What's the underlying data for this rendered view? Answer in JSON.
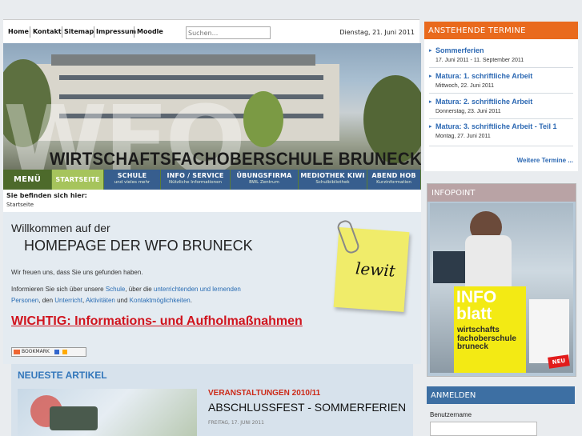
{
  "topnav": {
    "links": [
      "Home",
      "Kontakt",
      "Sitemap",
      "Impressum",
      "Moodle"
    ],
    "search_placeholder": "Suchen...",
    "date": "Dienstag, 21. Juni 2011"
  },
  "header": {
    "watermark": "WFO",
    "school_name": "WIRTSCHAFTSFACHOBERSCHULE BRUNECK"
  },
  "menu": {
    "menu_label": "MENÜ",
    "start_label": "STARTSEITE",
    "items": [
      {
        "title": "SCHULE",
        "sub": "und vieles mehr"
      },
      {
        "title": "INFO / SERVICE",
        "sub": "Nützliche Informationen"
      },
      {
        "title": "ÜBUNGSFIRMA",
        "sub": "BWL Zentrum"
      },
      {
        "title": "MEDIOTHEK KIWI",
        "sub": "Schulbibliothek"
      },
      {
        "title": "ABEND HOB",
        "sub": "Kurzinformation"
      }
    ]
  },
  "breadcrumb": {
    "label": "Sie befinden sich hier:",
    "current": "Startseite"
  },
  "welcome": {
    "line1": "Willkommen auf der",
    "line2": "HOMEPAGE DER WFO BRUNECK",
    "p1": "Wir freuen uns, dass Sie uns gefunden haben.",
    "p2_a": "Informieren Sie sich über unsere ",
    "link_schule": "Schule",
    "p2_b": ", über die ",
    "link_personen_1": "unterrichtenden und lernenden",
    "link_personen_2": "Personen",
    "p3_a": ", den ",
    "link_unterricht": "Unterricht",
    "p3_b": ", ",
    "link_aktivitaeten": "Aktivitäten",
    "p3_c": " und ",
    "link_kontakt": "Kontaktmöglichkeiten",
    "p3_d": ".",
    "wichtig": "WICHTIG: Informations- und Aufholmaßnahmen",
    "bookmark": "BOOKMARK",
    "note_text": "lewit"
  },
  "articles": {
    "title": "NEUESTE ARTIKEL",
    "category": "VERANSTALTUNGEN 2010/11",
    "headline": "ABSCHLUSSFEST - SOMMERFERIEN",
    "date": "FREITAG, 17. JUNI 2011"
  },
  "termine": {
    "title": "ANSTEHENDE TERMINE",
    "events": [
      {
        "name": "Sommerferien",
        "date": "17. Juni 2011 - 11. September 2011"
      },
      {
        "name": "Matura: 1. schriftliche Arbeit",
        "date": "Mittwoch, 22. Juni 2011"
      },
      {
        "name": "Matura: 2. schriftliche Arbeit",
        "date": "Donnerstag, 23. Juni 2011"
      },
      {
        "name": "Matura: 3. schriftliche Arbeit - Teil 1",
        "date": "Montag, 27. Juni 2011"
      }
    ],
    "more": "Weitere Termine ..."
  },
  "infopoint": {
    "title": "INFOPOINT",
    "info_1": "INFO",
    "info_2": "blatt",
    "info_3": "wirtschafts",
    "info_4": "fachoberschule",
    "info_5": "bruneck",
    "badge": "NEU"
  },
  "login": {
    "title": "ANMELDEN",
    "username_label": "Benutzername"
  },
  "colors": {
    "menu_green": "#5b7d33",
    "menu_blue": "#375e8e",
    "termine_orange": "#e96a1d",
    "link_blue": "#2a6db4",
    "alert_red": "#d0141e"
  }
}
